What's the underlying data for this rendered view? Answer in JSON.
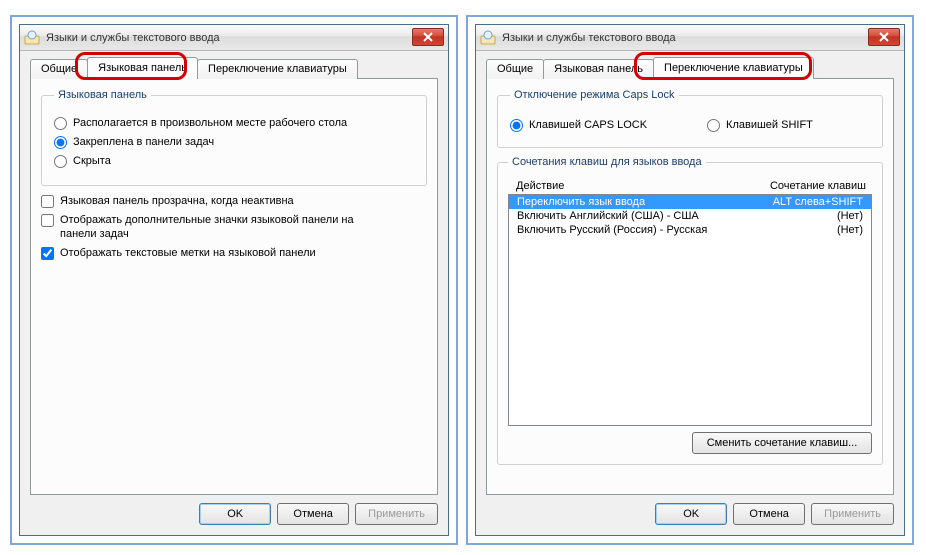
{
  "window_title": "Языки и службы текстового ввода",
  "tabs": {
    "general": "Общие",
    "langbar": "Языковая панель",
    "switch": "Переключение клавиатуры"
  },
  "buttons": {
    "ok": "OK",
    "cancel": "Отмена",
    "apply": "Применить"
  },
  "langbar_panel": {
    "group_title": "Языковая панель",
    "opt_float": "Располагается в произвольном месте рабочего стола",
    "opt_dock": "Закреплена в панели задач",
    "opt_hidden": "Скрыта",
    "chk_transparent": "Языковая панель прозрачна, когда неактивна",
    "chk_extra_icons": "Отображать дополнительные значки языковой панели на панели задач",
    "chk_text_labels": "Отображать текстовые метки на языковой панели"
  },
  "switch_panel": {
    "caps_group": "Отключение режима Caps Lock",
    "caps_capslock": "Клавишей CAPS LOCK",
    "caps_shift": "Клавишей SHIFT",
    "hotkeys_group": "Сочетания клавиш для языков ввода",
    "col_action": "Действие",
    "col_keys": "Сочетание клавиш",
    "rows": [
      {
        "action": "Переключить язык ввода",
        "keys": "ALT слева+SHIFT"
      },
      {
        "action": "Включить Английский (США) - США",
        "keys": "(Нет)"
      },
      {
        "action": "Включить Русский (Россия) - Русская",
        "keys": "(Нет)"
      }
    ],
    "change_btn": "Сменить сочетание клавиш..."
  }
}
